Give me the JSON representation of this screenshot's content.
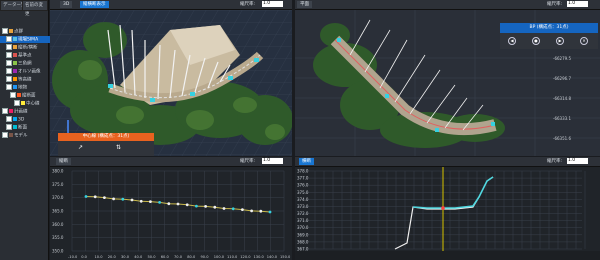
{
  "left_panel": {
    "tabs": [
      "データー覧",
      "名前の変更"
    ],
    "tree": [
      {
        "label": "点群"
      },
      {
        "label": "現場SIMA"
      },
      {
        "label": "縦断/横断"
      },
      {
        "label": "基準点"
      },
      {
        "label": "三角網"
      },
      {
        "label": "オルソ画像"
      },
      {
        "label": "等高線"
      },
      {
        "label": "地物"
      },
      {
        "label": "縦断面"
      },
      {
        "label": "中心線"
      },
      {
        "label": "計画線"
      },
      {
        "label": "3D"
      },
      {
        "label": "断面"
      },
      {
        "label": "モデル"
      }
    ]
  },
  "views": {
    "top_left": {
      "tabs": [
        "3D",
        "縦横断表示"
      ],
      "zoom_label": "縮尺率:",
      "zoom_value": "1.0"
    },
    "top_right": {
      "tabs": [
        "平面"
      ],
      "zoom_label": "縮尺率:",
      "zoom_value": "1.0"
    },
    "bottom_left": {
      "tabs": [
        "縦断"
      ],
      "zoom_label": "縮尺率:",
      "zoom_value": "1.0"
    },
    "bottom_right": {
      "tabs": [
        "横断"
      ],
      "zoom_label": "縮尺率:",
      "zoom_value": "1.0"
    }
  },
  "info_boxes": {
    "center_line": "中心線 (構成点：31点)",
    "bp": "BP (構成点：31点)",
    "left_buttons": [
      "↗",
      "⇅"
    ],
    "right_buttons": [
      "◀",
      "●",
      "▶",
      "✕"
    ]
  },
  "plan_axis": [
    "-66279.5",
    "-66296.7",
    "-66314.8",
    "-66333.1",
    "-66351.6"
  ],
  "profile_y_labels": [
    "380.0",
    "375.0",
    "370.0",
    "365.0",
    "360.0",
    "355.0",
    "350.0"
  ],
  "profile_x_labels": [
    "-10.0",
    "0.0",
    "10.0",
    "20.0",
    "30.0",
    "40.0",
    "50.0",
    "60.0",
    "70.0",
    "80.0",
    "90.0",
    "100.0",
    "110.0",
    "120.0",
    "130.0",
    "140.0",
    "150.0"
  ],
  "cross_y_labels": [
    "378.0",
    "377.0",
    "376.0",
    "375.0",
    "374.0",
    "373.0",
    "372.0",
    "371.0",
    "370.0",
    "369.0",
    "368.0",
    "367.0"
  ],
  "colors": {
    "accent": "#1976d2",
    "orange": "#e8621f",
    "profile_line": "#c9b94a",
    "cross_line": "#4fd8e0",
    "guide": "#d8c400"
  }
}
